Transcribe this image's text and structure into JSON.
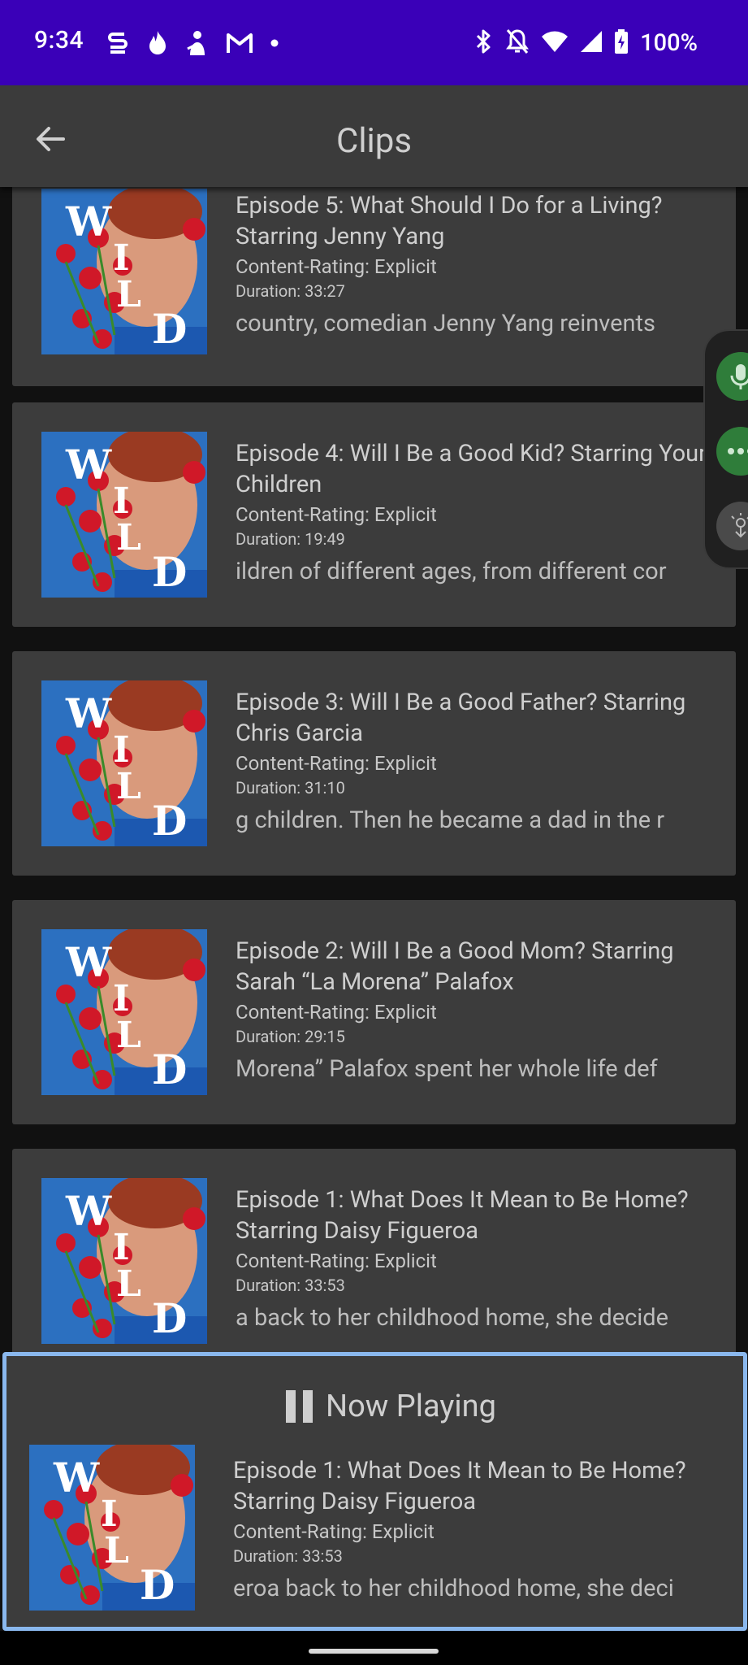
{
  "status_bar": {
    "time": "9:34",
    "battery_text": "100%",
    "background": "#3a00b8",
    "notification_icons": [
      "s-app-icon",
      "flame-icon",
      "person-icon",
      "gmail-icon",
      "more-dot-icon"
    ],
    "system_icons": [
      "bluetooth-icon",
      "bell-off-icon",
      "wifi-icon",
      "signal-icon",
      "battery-charging-icon"
    ]
  },
  "app_bar": {
    "title": "Clips",
    "back_icon": "arrow-left-icon"
  },
  "episodes": [
    {
      "title": "Episode 5: What Should I Do for a Living? Starring Jenny Yang",
      "rating": "Content-Rating: Explicit",
      "duration": "Duration: 33:27",
      "description": "country, comedian Jenny Yang reinvents"
    },
    {
      "title": "Episode 4: Will I Be a Good Kid? Starring Your Children",
      "rating": "Content-Rating: Explicit",
      "duration": "Duration: 19:49",
      "description": "ildren of different ages, from different cor"
    },
    {
      "title": "Episode 3: Will I Be a Good Father? Starring Chris Garcia",
      "rating": "Content-Rating: Explicit",
      "duration": "Duration: 31:10",
      "description": "g children. Then he became a dad in the r"
    },
    {
      "title": "Episode 2: Will I Be a Good Mom? Starring Sarah “La Morena” Palafox",
      "rating": "Content-Rating: Explicit",
      "duration": "Duration: 29:15",
      "description": "Morena” Palafox spent her whole life def"
    },
    {
      "title": "Episode 1: What Does It Mean to Be Home? Starring Daisy Figueroa",
      "rating": "Content-Rating: Explicit",
      "duration": "Duration: 33:53",
      "description": "a back to her childhood home, she decide"
    }
  ],
  "now_playing": {
    "label": "Now Playing",
    "icon": "pause-icon",
    "title": "Episode 1: What Does It Mean to Be Home? Starring Daisy Figueroa",
    "rating": "Content-Rating: Explicit",
    "duration": "Duration: 33:53",
    "description": "eroa back to her childhood home, she deci",
    "highlight_color": "#8ab8ee"
  },
  "cover_art": {
    "letters": [
      "W",
      "I",
      "L",
      "D"
    ]
  },
  "side_bubble": {
    "icons": [
      "microphone-icon",
      "more-horizontal-icon",
      "touch-icon"
    ]
  }
}
